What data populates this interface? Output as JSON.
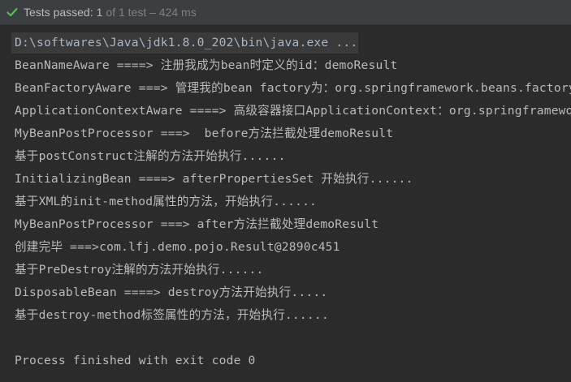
{
  "status": {
    "label": "Tests passed:",
    "count": "1",
    "detail": "of 1 test – 424 ms",
    "accent_color": "#5fb85f"
  },
  "console": {
    "command": "D:\\softwares\\Java\\jdk1.8.0_202\\bin\\java.exe ...",
    "lines": [
      "BeanNameAware ====> 注册我成为bean时定义的id：demoResult",
      "BeanFactoryAware ===> 管理我的bean factory为：org.springframework.beans.factory",
      "ApplicationContextAware ====> 高级容器接口ApplicationContext：org.springframework",
      "MyBeanPostProcessor ===>  before方法拦截处理demoResult",
      "基于postConstruct注解的方法开始执行......",
      "InitializingBean ====> afterPropertiesSet 开始执行......",
      "基于XML的init-method属性的方法，开始执行......",
      "MyBeanPostProcessor ===> after方法拦截处理demoResult",
      "创建完毕 ===>com.lfj.demo.pojo.Result@2890c451",
      "基于PreDestroy注解的方法开始执行......",
      "DisposableBean ====> destroy方法开始执行.....",
      "基于destroy-method标签属性的方法，开始执行......"
    ],
    "exit_message": "Process finished with exit code 0"
  }
}
